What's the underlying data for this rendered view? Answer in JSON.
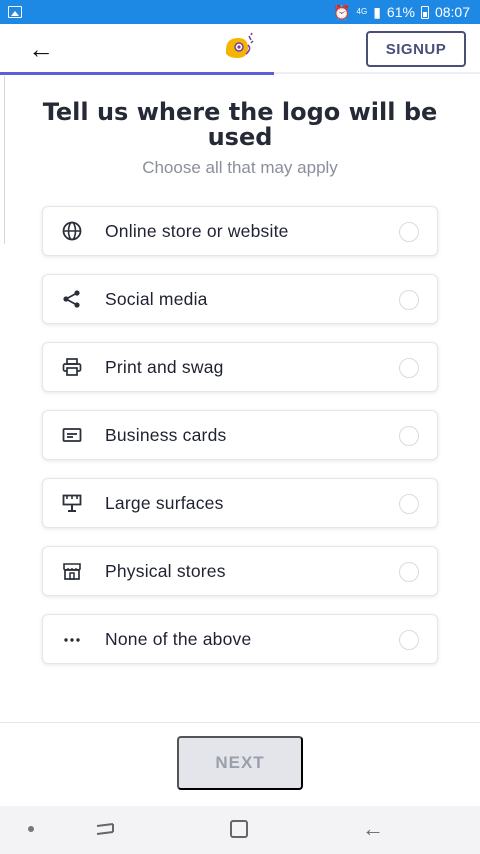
{
  "status_bar": {
    "battery": "61%",
    "time": "08:07",
    "network": "4G"
  },
  "header": {
    "signup_label": "SIGNUP",
    "progress_fraction": 0.57
  },
  "main": {
    "title": "Tell us where the logo will be used",
    "subtitle": "Choose all that may apply"
  },
  "options": [
    {
      "label": "Online store or website",
      "icon": "globe-icon",
      "selected": false
    },
    {
      "label": "Social media",
      "icon": "share-icon",
      "selected": false
    },
    {
      "label": "Print and swag",
      "icon": "printer-icon",
      "selected": false
    },
    {
      "label": "Business cards",
      "icon": "card-icon",
      "selected": false
    },
    {
      "label": "Large surfaces",
      "icon": "billboard-icon",
      "selected": false
    },
    {
      "label": "Physical stores",
      "icon": "storefront-icon",
      "selected": false
    },
    {
      "label": "None of the above",
      "icon": "more-dots-icon",
      "selected": false
    }
  ],
  "footer": {
    "next_label": "NEXT"
  },
  "colors": {
    "status_bar": "#1e88e5",
    "accent": "#5c5fd6",
    "signup_border": "#4a4f7a",
    "next_disabled_bg": "#e3e5ea"
  }
}
